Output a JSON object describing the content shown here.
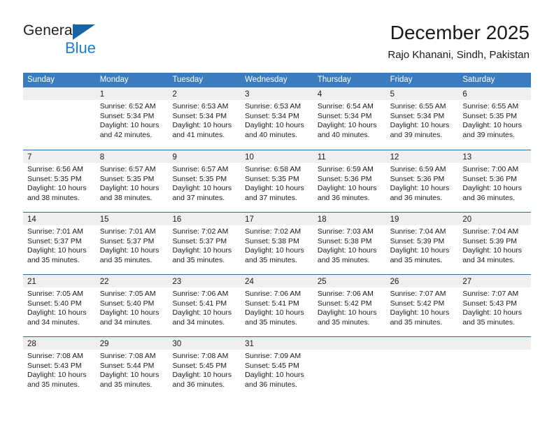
{
  "brand": {
    "name_part1": "General",
    "name_part2": "Blue",
    "triangle_icon": "triangle-icon",
    "colors": {
      "dark": "#231f20",
      "blue": "#1b7fd4",
      "triangle": "#1565a8"
    }
  },
  "header": {
    "title": "December 2025",
    "subtitle": "Rajo Khanani, Sindh, Pakistan"
  },
  "colors": {
    "header_row_bg": "#3a7cbe",
    "week_separator": "#2b6cad",
    "day_band_bg": "#efefef",
    "cell_bg": "#ffffff",
    "text": "#1a1a1a"
  },
  "weekdays": [
    "Sunday",
    "Monday",
    "Tuesday",
    "Wednesday",
    "Thursday",
    "Friday",
    "Saturday"
  ],
  "weeks": [
    [
      {
        "day": "",
        "lines": []
      },
      {
        "day": "1",
        "lines": [
          "Sunrise: 6:52 AM",
          "Sunset: 5:34 PM",
          "Daylight: 10 hours",
          "and 42 minutes."
        ]
      },
      {
        "day": "2",
        "lines": [
          "Sunrise: 6:53 AM",
          "Sunset: 5:34 PM",
          "Daylight: 10 hours",
          "and 41 minutes."
        ]
      },
      {
        "day": "3",
        "lines": [
          "Sunrise: 6:53 AM",
          "Sunset: 5:34 PM",
          "Daylight: 10 hours",
          "and 40 minutes."
        ]
      },
      {
        "day": "4",
        "lines": [
          "Sunrise: 6:54 AM",
          "Sunset: 5:34 PM",
          "Daylight: 10 hours",
          "and 40 minutes."
        ]
      },
      {
        "day": "5",
        "lines": [
          "Sunrise: 6:55 AM",
          "Sunset: 5:34 PM",
          "Daylight: 10 hours",
          "and 39 minutes."
        ]
      },
      {
        "day": "6",
        "lines": [
          "Sunrise: 6:55 AM",
          "Sunset: 5:35 PM",
          "Daylight: 10 hours",
          "and 39 minutes."
        ]
      }
    ],
    [
      {
        "day": "7",
        "lines": [
          "Sunrise: 6:56 AM",
          "Sunset: 5:35 PM",
          "Daylight: 10 hours",
          "and 38 minutes."
        ]
      },
      {
        "day": "8",
        "lines": [
          "Sunrise: 6:57 AM",
          "Sunset: 5:35 PM",
          "Daylight: 10 hours",
          "and 38 minutes."
        ]
      },
      {
        "day": "9",
        "lines": [
          "Sunrise: 6:57 AM",
          "Sunset: 5:35 PM",
          "Daylight: 10 hours",
          "and 37 minutes."
        ]
      },
      {
        "day": "10",
        "lines": [
          "Sunrise: 6:58 AM",
          "Sunset: 5:35 PM",
          "Daylight: 10 hours",
          "and 37 minutes."
        ]
      },
      {
        "day": "11",
        "lines": [
          "Sunrise: 6:59 AM",
          "Sunset: 5:36 PM",
          "Daylight: 10 hours",
          "and 36 minutes."
        ]
      },
      {
        "day": "12",
        "lines": [
          "Sunrise: 6:59 AM",
          "Sunset: 5:36 PM",
          "Daylight: 10 hours",
          "and 36 minutes."
        ]
      },
      {
        "day": "13",
        "lines": [
          "Sunrise: 7:00 AM",
          "Sunset: 5:36 PM",
          "Daylight: 10 hours",
          "and 36 minutes."
        ]
      }
    ],
    [
      {
        "day": "14",
        "lines": [
          "Sunrise: 7:01 AM",
          "Sunset: 5:37 PM",
          "Daylight: 10 hours",
          "and 35 minutes."
        ]
      },
      {
        "day": "15",
        "lines": [
          "Sunrise: 7:01 AM",
          "Sunset: 5:37 PM",
          "Daylight: 10 hours",
          "and 35 minutes."
        ]
      },
      {
        "day": "16",
        "lines": [
          "Sunrise: 7:02 AM",
          "Sunset: 5:37 PM",
          "Daylight: 10 hours",
          "and 35 minutes."
        ]
      },
      {
        "day": "17",
        "lines": [
          "Sunrise: 7:02 AM",
          "Sunset: 5:38 PM",
          "Daylight: 10 hours",
          "and 35 minutes."
        ]
      },
      {
        "day": "18",
        "lines": [
          "Sunrise: 7:03 AM",
          "Sunset: 5:38 PM",
          "Daylight: 10 hours",
          "and 35 minutes."
        ]
      },
      {
        "day": "19",
        "lines": [
          "Sunrise: 7:04 AM",
          "Sunset: 5:39 PM",
          "Daylight: 10 hours",
          "and 35 minutes."
        ]
      },
      {
        "day": "20",
        "lines": [
          "Sunrise: 7:04 AM",
          "Sunset: 5:39 PM",
          "Daylight: 10 hours",
          "and 34 minutes."
        ]
      }
    ],
    [
      {
        "day": "21",
        "lines": [
          "Sunrise: 7:05 AM",
          "Sunset: 5:40 PM",
          "Daylight: 10 hours",
          "and 34 minutes."
        ]
      },
      {
        "day": "22",
        "lines": [
          "Sunrise: 7:05 AM",
          "Sunset: 5:40 PM",
          "Daylight: 10 hours",
          "and 34 minutes."
        ]
      },
      {
        "day": "23",
        "lines": [
          "Sunrise: 7:06 AM",
          "Sunset: 5:41 PM",
          "Daylight: 10 hours",
          "and 34 minutes."
        ]
      },
      {
        "day": "24",
        "lines": [
          "Sunrise: 7:06 AM",
          "Sunset: 5:41 PM",
          "Daylight: 10 hours",
          "and 35 minutes."
        ]
      },
      {
        "day": "25",
        "lines": [
          "Sunrise: 7:06 AM",
          "Sunset: 5:42 PM",
          "Daylight: 10 hours",
          "and 35 minutes."
        ]
      },
      {
        "day": "26",
        "lines": [
          "Sunrise: 7:07 AM",
          "Sunset: 5:42 PM",
          "Daylight: 10 hours",
          "and 35 minutes."
        ]
      },
      {
        "day": "27",
        "lines": [
          "Sunrise: 7:07 AM",
          "Sunset: 5:43 PM",
          "Daylight: 10 hours",
          "and 35 minutes."
        ]
      }
    ],
    [
      {
        "day": "28",
        "lines": [
          "Sunrise: 7:08 AM",
          "Sunset: 5:43 PM",
          "Daylight: 10 hours",
          "and 35 minutes."
        ]
      },
      {
        "day": "29",
        "lines": [
          "Sunrise: 7:08 AM",
          "Sunset: 5:44 PM",
          "Daylight: 10 hours",
          "and 35 minutes."
        ]
      },
      {
        "day": "30",
        "lines": [
          "Sunrise: 7:08 AM",
          "Sunset: 5:45 PM",
          "Daylight: 10 hours",
          "and 36 minutes."
        ]
      },
      {
        "day": "31",
        "lines": [
          "Sunrise: 7:09 AM",
          "Sunset: 5:45 PM",
          "Daylight: 10 hours",
          "and 36 minutes."
        ]
      },
      {
        "day": "",
        "lines": []
      },
      {
        "day": "",
        "lines": []
      },
      {
        "day": "",
        "lines": []
      }
    ]
  ]
}
